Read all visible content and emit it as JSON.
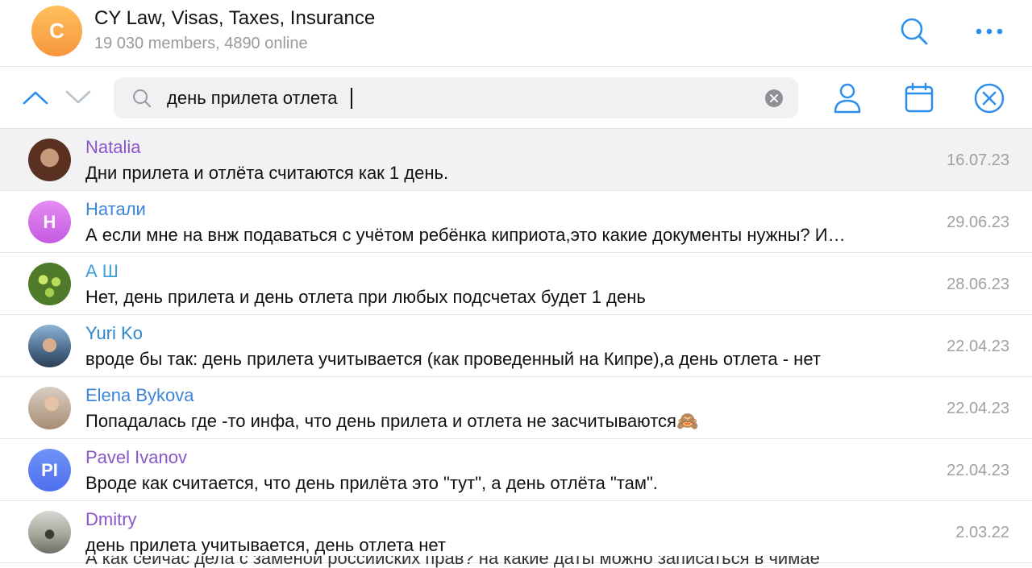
{
  "header": {
    "avatar_letter": "C",
    "title": "CY Law, Visas, Taxes, Insurance",
    "subtitle": "19 030 members, 4890 online",
    "search_icon": "search-icon",
    "more_icon": "more-dots-icon"
  },
  "search": {
    "query": "день прилета отлета",
    "clear_icon": "clear-circle-icon",
    "up_icon": "chevron-up-icon",
    "down_icon": "chevron-down-icon",
    "filter_user_icon": "person-icon",
    "calendar_icon": "calendar-icon",
    "close_icon": "close-circle-icon"
  },
  "results": [
    {
      "name": "Natalia",
      "name_color": "#8a55c9",
      "text": "Дни прилета и отлёта считаются как 1 день.",
      "date": "16.07.23",
      "avatar": "photo",
      "avatar_bg": "#5a3020"
    },
    {
      "name": "Натали",
      "name_color": "#3d85d8",
      "text": "А если мне на внж подаваться с учётом ребёнка киприота,это какие документы нужны? И…",
      "date": "29.06.23",
      "avatar": "H",
      "avatar_bg": "#d36ee8"
    },
    {
      "name": "А Ш",
      "name_color": "#3fa0d8",
      "text": "Нет, день прилета и день отлета при любых подсчетах будет 1 день",
      "date": "28.06.23",
      "avatar": "photo",
      "avatar_bg": "#7cb33a"
    },
    {
      "name": "Yuri Ko",
      "name_color": "#2f86c9",
      "text": "вроде бы так: день прилета учитывается (как проведенный на Кипре),а день отлета - нет",
      "date": "22.04.23",
      "avatar": "photo",
      "avatar_bg": "#4a6a8c"
    },
    {
      "name": "Elena Bykova",
      "name_color": "#3d85d8",
      "text": "Попадалась где -то инфа, что день прилета и отлета не засчитываются🙈",
      "date": "22.04.23",
      "avatar": "photo",
      "avatar_bg": "#a88c74"
    },
    {
      "name": "Pavel Ivanov",
      "name_color": "#8a55c9",
      "text": "Вроде как считается, что день прилёта это \"тут\", а день отлёта \"там\".",
      "date": "22.04.23",
      "avatar": "PI",
      "avatar_bg": "#5b7df0"
    },
    {
      "name": "Dmitry",
      "name_color": "#8a55c9",
      "text": "день прилета учитывается, день отлета нет",
      "date": "2.03.22",
      "avatar": "photo",
      "avatar_bg": "#8a8f86"
    }
  ],
  "peek_text": "А как сейчас дела с заменой российских прав? на какие даты можно записаться в чимае"
}
